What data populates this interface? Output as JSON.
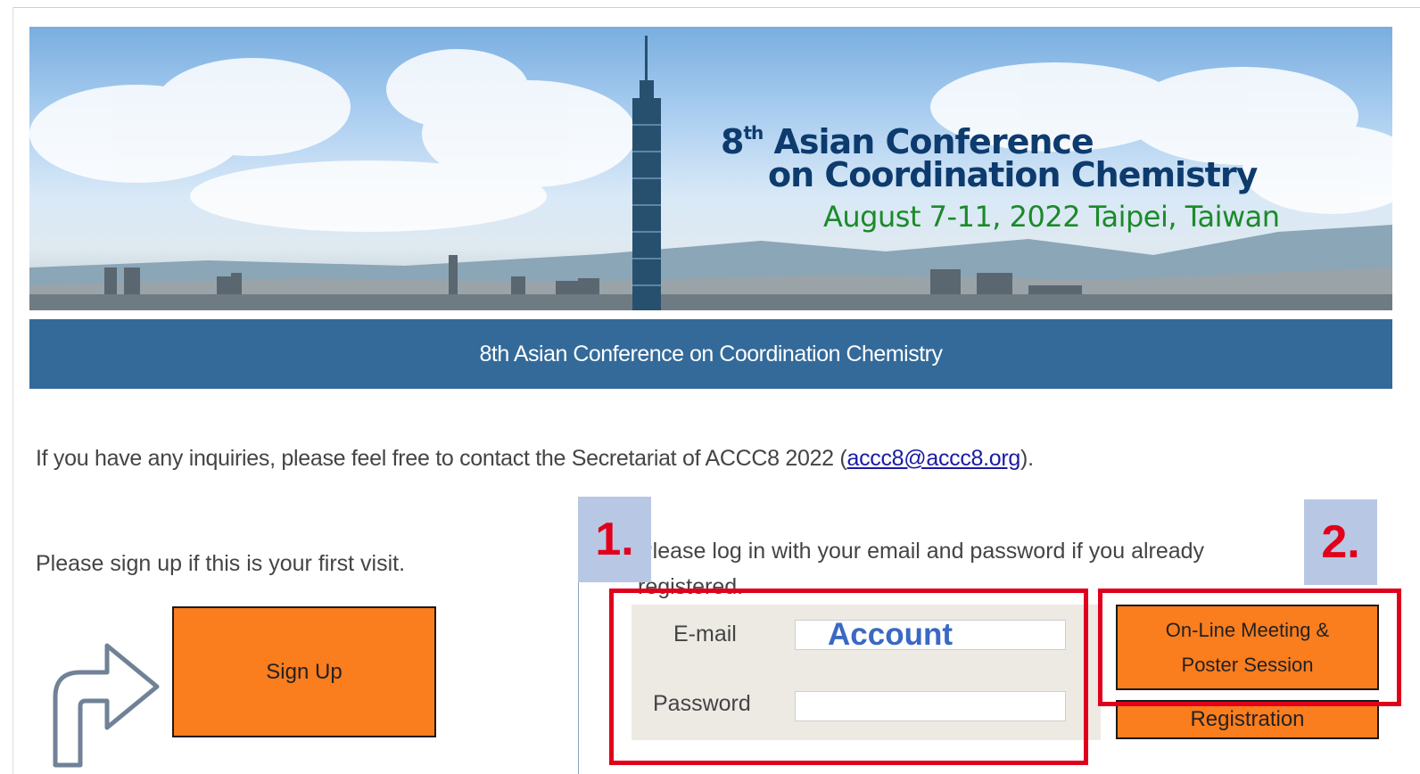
{
  "banner": {
    "title_number": "8",
    "title_sup": "th",
    "title_line1": "Asian Conference",
    "title_line2": "on Coordination Chemistry",
    "date_location": "August  7-11, 2022  Taipei, Taiwan"
  },
  "title_bar": {
    "text": "8th Asian Conference on Coordination Chemistry"
  },
  "inquiry": {
    "prefix": "If you have any inquiries, please feel free to contact the Secretariat of ACCC8 2022 (",
    "email": "accc8@accc8.org",
    "suffix": ")."
  },
  "signup": {
    "prompt": "Please sign up if this is your first visit.",
    "button_label": "Sign Up"
  },
  "login": {
    "prompt": "Please log in with your email and password if you already registered.",
    "email_label": "E-mail",
    "password_label": "Password",
    "email_value": "",
    "password_value": ""
  },
  "annotations": {
    "step1": "1.",
    "step2": "2.",
    "account_overlay": "Account"
  },
  "actions": {
    "online_line1": "On-Line Meeting &",
    "online_line2": "Poster Session",
    "registration": "Registration"
  },
  "colors": {
    "title_bar": "#336a99",
    "button_orange": "#fa7d1e",
    "highlight_red": "#e0001b",
    "annotation_bg": "#b8c8e4",
    "banner_title": "#0d3b6e",
    "banner_date": "#1b8a2a"
  },
  "icons": {
    "turn_arrow": "curved-arrow-icon"
  }
}
